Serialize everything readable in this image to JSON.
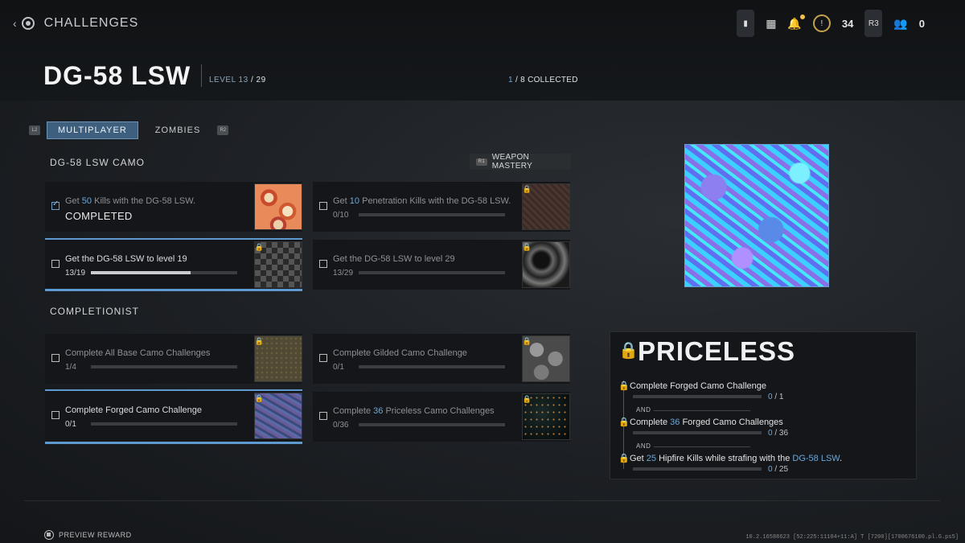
{
  "header": {
    "back_title": "CHALLENGES",
    "weapon_name": "DG-58 LSW",
    "level_label": "LEVEL 13",
    "level_max": "/ 29",
    "collected_current": "1",
    "collected_rest": "/ 8 COLLECTED"
  },
  "hud": {
    "currency_count": "34",
    "party_count": "0",
    "key_label": "R3"
  },
  "tabs": [
    {
      "label": "MULTIPLAYER",
      "active": true
    },
    {
      "label": "ZOMBIES",
      "active": false
    }
  ],
  "tab_keys": {
    "left": "L2",
    "right": "R2"
  },
  "sections": {
    "camo_title": "DG-58 LSW CAMO",
    "mastery_label": "WEAPON MASTERY",
    "mastery_key": "R1",
    "completionist_title": "COMPLETIONIST"
  },
  "camo_cards": [
    {
      "text_pre": "Get ",
      "hi": "50",
      "text_post": " Kills with the DG-58 LSW.",
      "status": "COMPLETED"
    },
    {
      "text_pre": "Get ",
      "hi": "10",
      "text_post": " Penetration Kills with the DG-58 LSW.",
      "progress": "0/10",
      "fill": 0
    },
    {
      "text": "Get the DG-58 LSW to level 19",
      "progress": "13/19",
      "fill": 0.68
    },
    {
      "text": "Get the DG-58 LSW to level 29",
      "progress": "13/29",
      "fill": 0
    }
  ],
  "completionist_cards": [
    {
      "text": "Complete All Base Camo Challenges",
      "progress": "1/4",
      "fill": 0
    },
    {
      "text": "Complete Gilded Camo Challenge",
      "progress": "0/1",
      "fill": 0
    },
    {
      "text": "Complete Forged Camo Challenge",
      "progress": "0/1",
      "fill": 0
    },
    {
      "text_pre": "Complete ",
      "hi": "36",
      "text_post": " Priceless Camo Challenges",
      "progress": "0/36",
      "fill": 0
    }
  ],
  "priceless": {
    "title": "PRICELESS",
    "and": "AND",
    "requirements": [
      {
        "text_pre": "Complete Forged Camo Challenge",
        "hi": "",
        "text_post": "",
        "current": "0",
        "total": "/ 1"
      },
      {
        "text_pre": "Complete ",
        "hi": "36",
        "text_post": " Forged Camo Challenges",
        "current": "0",
        "total": "/ 36"
      },
      {
        "text_pre": "Get ",
        "hi": "25",
        "text_post": " Hipfire Kills while strafing with the ",
        "hi2": "DG-58 LSW",
        "text_post2": ".",
        "current": "0",
        "total": "/ 25"
      }
    ]
  },
  "footer": {
    "preview_reward": "PREVIEW REWARD",
    "build_info": "10.2.16588623 [52:225:11104+11:A] T [7200][1700676100.pl.G.ps5]"
  }
}
